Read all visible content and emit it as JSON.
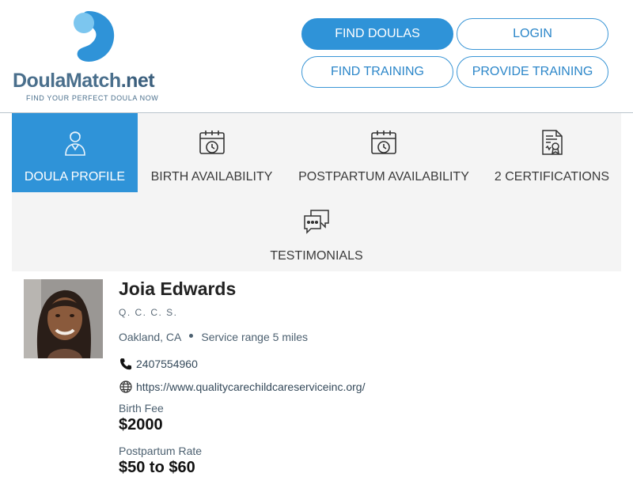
{
  "logo": {
    "name_main": "DoulaMatch",
    "name_suffix": ".net",
    "tagline": "FIND YOUR PERFECT DOULA NOW"
  },
  "nav": {
    "find_doulas": "FIND DOULAS",
    "login": "LOGIN",
    "find_training": "FIND TRAINING",
    "provide_training": "PROVIDE TRAINING"
  },
  "tabs": [
    {
      "label": "DOULA PROFILE",
      "icon": "person-icon",
      "active": true
    },
    {
      "label": "BIRTH AVAILABILITY",
      "icon": "calendar-clock-icon",
      "active": false
    },
    {
      "label": "POSTPARTUM AVAILABILITY",
      "icon": "calendar-clock-icon",
      "active": false
    },
    {
      "label": "2 CERTIFICATIONS",
      "icon": "certificate-icon",
      "active": false
    },
    {
      "label": "TESTIMONIALS",
      "icon": "chat-bubbles-icon",
      "active": false
    }
  ],
  "profile": {
    "name": "Joia Edwards",
    "company": "Q. C. C. S.",
    "location": "Oakland, CA",
    "service_range": "Service range 5 miles",
    "phone": "2407554960",
    "website": "https://www.qualitycarechildcareserviceinc.org/",
    "birth_fee_label": "Birth Fee",
    "birth_fee": "$2000",
    "postpartum_label": "Postpartum Rate",
    "postpartum_rate": "$50 to $60"
  },
  "colors": {
    "accent": "#2f93d8",
    "tab_bg": "#f4f4f4",
    "logo_text": "#4a6f8c"
  }
}
